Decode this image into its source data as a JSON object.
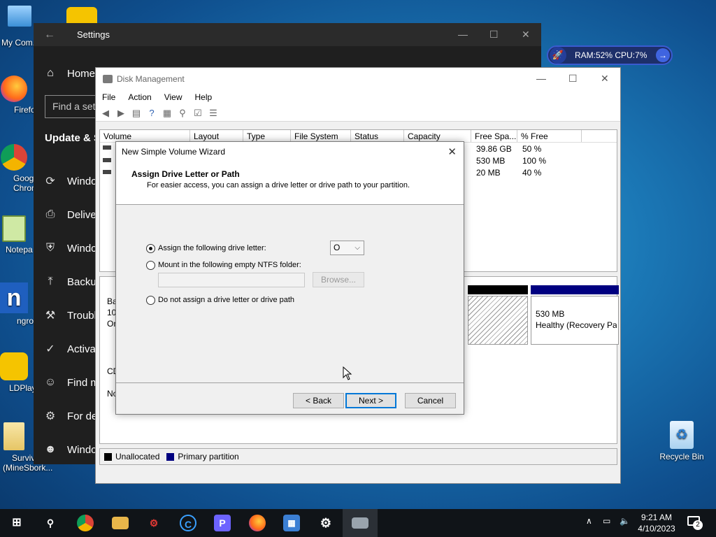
{
  "desktop": {
    "icons": [
      {
        "label": "My Com..."
      },
      {
        "label": "Firefo"
      },
      {
        "label": "Goog"
      },
      {
        "label": "Chrom"
      },
      {
        "label": "Notepa"
      },
      {
        "label": "ngro"
      },
      {
        "label": "LDPlay"
      },
      {
        "label": "Surviv"
      },
      {
        "label": "(MineSbork..."
      },
      {
        "label": "Recycle Bin"
      }
    ],
    "widget": {
      "text": "RAM:52%  CPU:7%",
      "arrow": "→"
    }
  },
  "settings": {
    "title": "Settings",
    "home": "Home",
    "search_placeholder": "Find a sett",
    "section": "Update & S",
    "nav": [
      {
        "label": "Windo",
        "icon": "refresh-icon"
      },
      {
        "label": "Deliver",
        "icon": "delivery-icon"
      },
      {
        "label": "Windo",
        "icon": "shield-icon"
      },
      {
        "label": "Backup",
        "icon": "backup-icon"
      },
      {
        "label": "Troubl",
        "icon": "wrench-icon"
      },
      {
        "label": "Activat",
        "icon": "check-circle-icon"
      },
      {
        "label": "Find m",
        "icon": "person-icon"
      },
      {
        "label": "For dev",
        "icon": "dev-icon"
      },
      {
        "label": "Windo",
        "icon": "cat-icon"
      }
    ]
  },
  "disk_management": {
    "title": "Disk Management",
    "menu": [
      "File",
      "Action",
      "View",
      "Help"
    ],
    "columns": [
      "Volume",
      "Layout",
      "Type",
      "File System",
      "Status",
      "Capacity",
      "Free Spa...",
      "% Free"
    ],
    "rows": [
      {
        "free": "39.86 GB",
        "pct": "50 %"
      },
      {
        "free": "530 MB",
        "pct": "100 %"
      },
      {
        "free": "20 MB",
        "pct": "40 %"
      }
    ],
    "disk_labels": {
      "d0_a": "Bas",
      "d0_b": "100",
      "d0_c": "On",
      "d1_a": "CD",
      "d1_b": "No"
    },
    "recovery": {
      "size": "530 MB",
      "status": "Healthy (Recovery Pa"
    },
    "legend": [
      {
        "label": "Unallocated",
        "color": "#000000"
      },
      {
        "label": "Primary partition",
        "color": "#000080"
      }
    ]
  },
  "wizard": {
    "title": "New Simple Volume Wizard",
    "heading": "Assign Drive Letter or Path",
    "subheading": "For easier access, you can assign a drive letter or drive path to your partition.",
    "option_assign": "Assign the following drive letter:",
    "drive_letter": "O",
    "option_mount": "Mount in the following empty NTFS folder:",
    "browse": "Browse...",
    "option_none": "Do not assign a drive letter or drive path",
    "back": "< Back",
    "next": "Next >",
    "cancel": "Cancel"
  },
  "taskbar": {
    "time": "9:21 AM",
    "date": "4/10/2023",
    "notifications": "2"
  }
}
